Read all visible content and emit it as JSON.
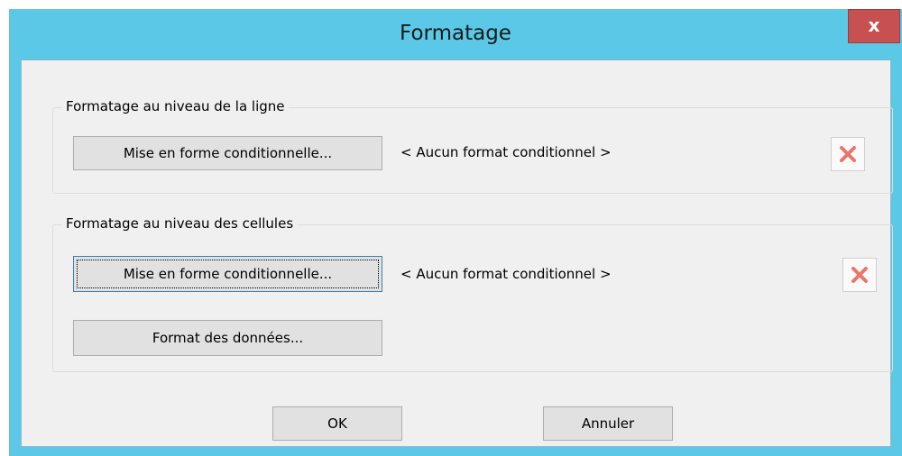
{
  "window": {
    "title": "Formatage",
    "close_label": "x"
  },
  "row_group": {
    "legend": "Formatage au niveau de la ligne",
    "conditional_button": "Mise en forme conditionnelle...",
    "status": "< Aucun format conditionnel >",
    "remove_icon": "x-icon"
  },
  "cell_group": {
    "legend": "Formatage au niveau des cellules",
    "conditional_button": "Mise en forme conditionnelle...",
    "status": "< Aucun format conditionnel >",
    "data_format_button": "Format des données...",
    "remove_icon": "x-icon"
  },
  "footer": {
    "ok_label": "OK",
    "cancel_label": "Annuler"
  },
  "colors": {
    "titlebar": "#5bc8e8",
    "close": "#c75050",
    "remove_x": "#e8766d"
  }
}
